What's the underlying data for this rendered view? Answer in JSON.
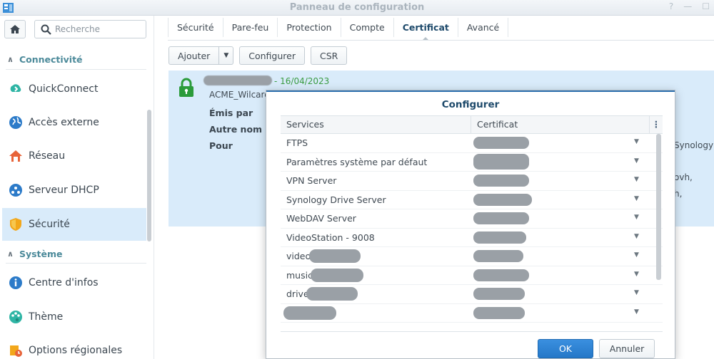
{
  "window": {
    "title": "Panneau de configuration"
  },
  "sidebar": {
    "search_placeholder": "Recherche",
    "sections": [
      {
        "label": "Connectivité"
      },
      {
        "label": "Système"
      }
    ],
    "items": [
      {
        "label": "QuickConnect",
        "icon": "quickconnect-icon"
      },
      {
        "label": "Accès externe",
        "icon": "globe-icon"
      },
      {
        "label": "Réseau",
        "icon": "network-house-icon"
      },
      {
        "label": "Serveur DHCP",
        "icon": "dhcp-icon"
      },
      {
        "label": "Sécurité",
        "icon": "shield-icon",
        "active": true
      },
      {
        "label": "Centre d'infos",
        "icon": "info-icon"
      },
      {
        "label": "Thème",
        "icon": "palette-icon"
      },
      {
        "label": "Options régionales",
        "icon": "regional-options-icon"
      }
    ]
  },
  "tabs": [
    {
      "label": "Sécurité"
    },
    {
      "label": "Pare-feu"
    },
    {
      "label": "Protection"
    },
    {
      "label": "Compte"
    },
    {
      "label": "Certificat",
      "active": true
    },
    {
      "label": "Avancé"
    }
  ],
  "toolbar": {
    "add_label": "Ajouter",
    "configure_label": "Configurer",
    "csr_label": "CSR"
  },
  "certificate": {
    "date": "- 16/04/2023",
    "name": "ACME_Wilcard_",
    "issued_by_label": "Émis par",
    "alt_name_label": "Autre nom de",
    "for_label": "Pour",
    "right_text_1": "Synology",
    "right_text_2": "ovh,",
    "right_text_3": "h,"
  },
  "dialog": {
    "title": "Configurer",
    "col_services": "Services",
    "col_certificate": "Certificat",
    "rows": [
      {
        "service": "FTPS"
      },
      {
        "service": "Paramètres système par défaut"
      },
      {
        "service": "VPN Server"
      },
      {
        "service": "Synology Drive Server"
      },
      {
        "service": "WebDAV Server"
      },
      {
        "service": "VideoStation - 9008"
      },
      {
        "service": "video."
      },
      {
        "service": "music."
      },
      {
        "service": "drive."
      },
      {
        "service": ""
      }
    ],
    "ok_label": "OK",
    "cancel_label": "Annuler"
  },
  "colors": {
    "accent": "#2578c8",
    "selected_bg": "#d9ebfa",
    "date_green": "#3a9b41"
  }
}
